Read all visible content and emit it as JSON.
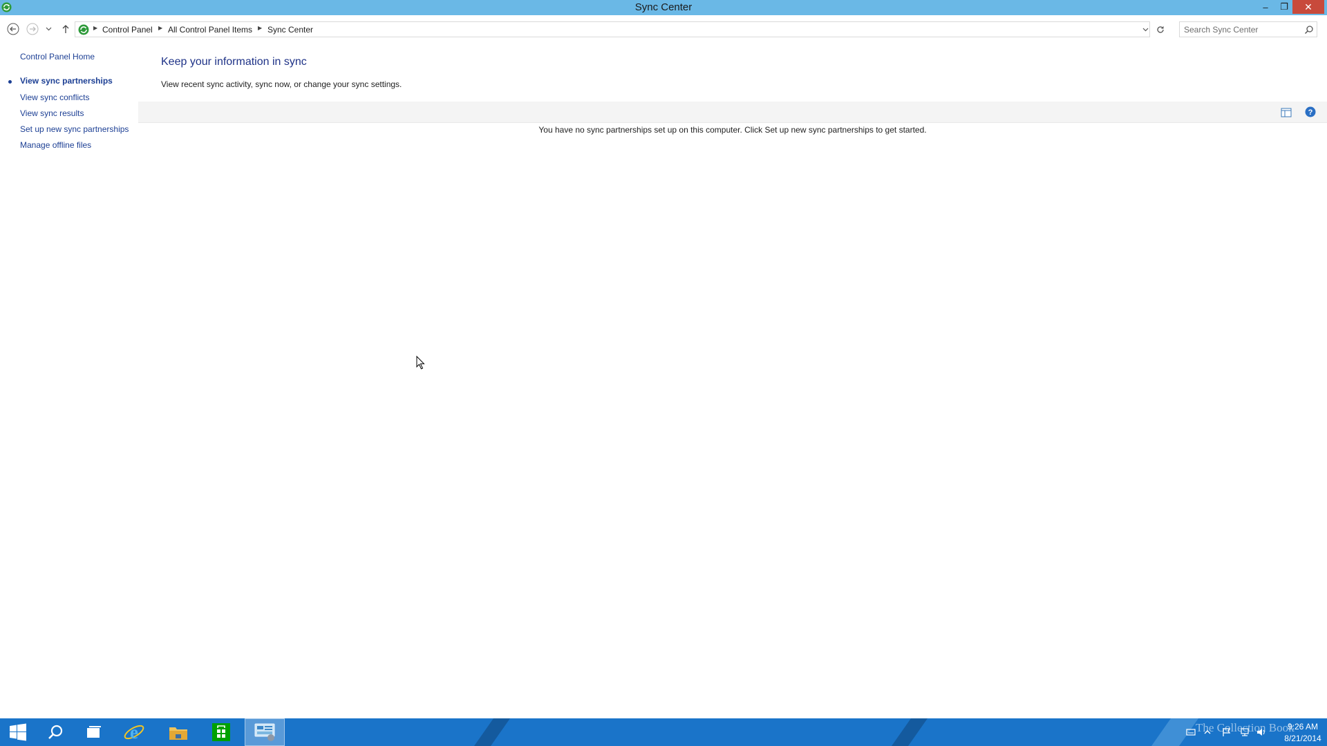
{
  "window": {
    "title": "Sync Center",
    "minimize_glyph": "–",
    "maximize_glyph": "❐",
    "close_glyph": "✕"
  },
  "address_bar": {
    "breadcrumbs": [
      "Control Panel",
      "All Control Panel Items",
      "Sync Center"
    ],
    "search_placeholder": "Search Sync Center"
  },
  "left_pane": {
    "home_link": "Control Panel Home",
    "tasks": [
      {
        "label": "View sync partnerships",
        "current": true
      },
      {
        "label": "View sync conflicts",
        "current": false
      },
      {
        "label": "View sync results",
        "current": false
      },
      {
        "label": "Set up new sync partnerships",
        "current": false
      },
      {
        "label": "Manage offline files",
        "current": false
      }
    ]
  },
  "main": {
    "heading": "Keep your information in sync",
    "subheading": "View recent sync activity, sync now, or change your sync settings.",
    "empty_message": "You have no sync partnerships set up on this computer. Click Set up new sync partnerships to get started."
  },
  "taskbar": {
    "items": [
      "start-button",
      "search",
      "task-view",
      "internet-explorer",
      "file-explorer",
      "store",
      "control-panel"
    ],
    "active_item": "control-panel",
    "watermark": "The Collection Book",
    "clock_time": "9:26 AM",
    "clock_date": "8/21/2014"
  },
  "colors": {
    "titlebar": "#6ab8e6",
    "close_button": "#c84a3b",
    "link": "#1c3f94",
    "heading": "#1e3287",
    "taskbar": "#1a74c9"
  }
}
